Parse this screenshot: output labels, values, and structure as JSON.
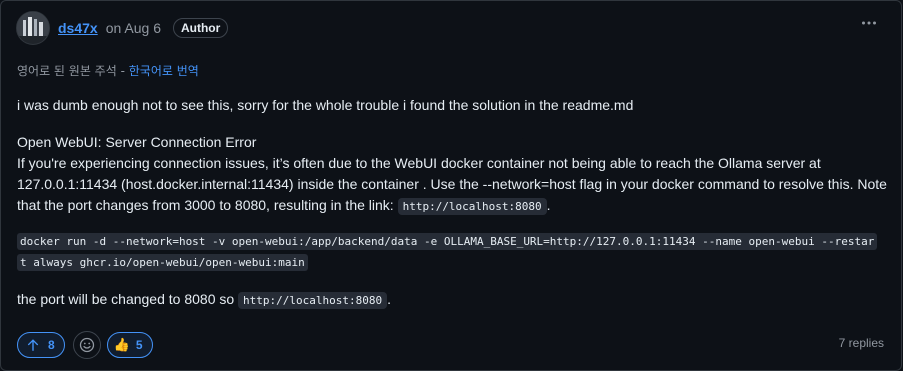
{
  "comment": {
    "author": "ds47x",
    "date": "on Aug 6",
    "badge": "Author",
    "translation": {
      "notice": "영어로 된 원본 주석 - ",
      "link": "한국어로 번역"
    },
    "paragraph1": "i was dumb enough not to see this, sorry for the whole trouble i found the solution in the readme.md",
    "heading": "Open WebUI: Server Connection Error",
    "paragraph2": "If you're experiencing connection issues, it’s often due to the WebUI docker container not being able to reach the Ollama server at 127.0.0.1:11434 (host.docker.internal:11434) inside the container . Use the --network=host flag in your docker command to resolve this. Note that the port changes from 3000 to 8080, resulting in the link: ",
    "link_code": "http://localhost:8080",
    "period": ".",
    "command": "docker run -d --network=host -v open-webui:/app/backend/data -e OLLAMA_BASE_URL=http://127.0.0.1:11434 --name open-webui --restart always ghcr.io/open-webui/open-webui:main",
    "paragraph3": "the port will be changed to 8080 so ",
    "link_code2": "http://localhost:8080",
    "period2": "."
  },
  "footer": {
    "upvotes": "8",
    "reaction_emoji": "👍",
    "reaction_count": "5",
    "replies": "7 replies"
  },
  "icons": {
    "upvote": "arrow-up-icon",
    "emoji_picker": "smiley-icon",
    "more": "kebab-horizontal-icon"
  },
  "colors": {
    "accent": "#4493f8",
    "background": "#0d1117",
    "muted_text": "#9198a1"
  }
}
